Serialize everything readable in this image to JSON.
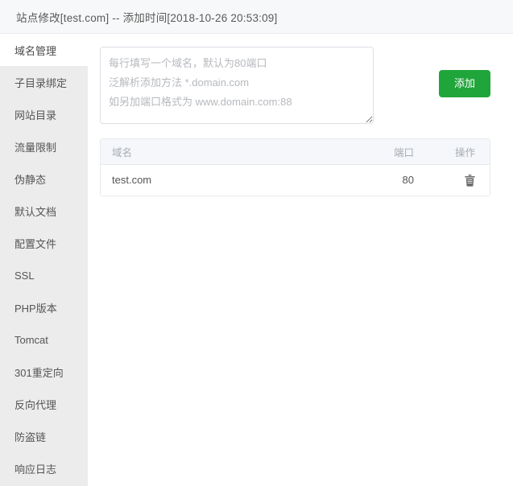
{
  "window": {
    "title": "站点修改[test.com] -- 添加时间[2018-10-26 20:53:09]"
  },
  "sidebar": {
    "items": [
      {
        "label": "域名管理",
        "active": true
      },
      {
        "label": "子目录绑定",
        "active": false
      },
      {
        "label": "网站目录",
        "active": false
      },
      {
        "label": "流量限制",
        "active": false
      },
      {
        "label": "伪静态",
        "active": false
      },
      {
        "label": "默认文档",
        "active": false
      },
      {
        "label": "配置文件",
        "active": false
      },
      {
        "label": "SSL",
        "active": false
      },
      {
        "label": "PHP版本",
        "active": false
      },
      {
        "label": "Tomcat",
        "active": false
      },
      {
        "label": "301重定向",
        "active": false
      },
      {
        "label": "反向代理",
        "active": false
      },
      {
        "label": "防盗链",
        "active": false
      },
      {
        "label": "响应日志",
        "active": false
      }
    ]
  },
  "main": {
    "domain_input": {
      "value": "",
      "placeholder": "每行填写一个域名，默认为80端口\n泛解析添加方法 *.domain.com\n如另加端口格式为 www.domain.com:88"
    },
    "add_button": {
      "label": "添加",
      "color": "#20a53a"
    },
    "table": {
      "columns": [
        "域名",
        "端口",
        "操作"
      ],
      "rows": [
        {
          "domain": "test.com",
          "port": "80",
          "action_icon": "trash-icon"
        }
      ]
    }
  }
}
